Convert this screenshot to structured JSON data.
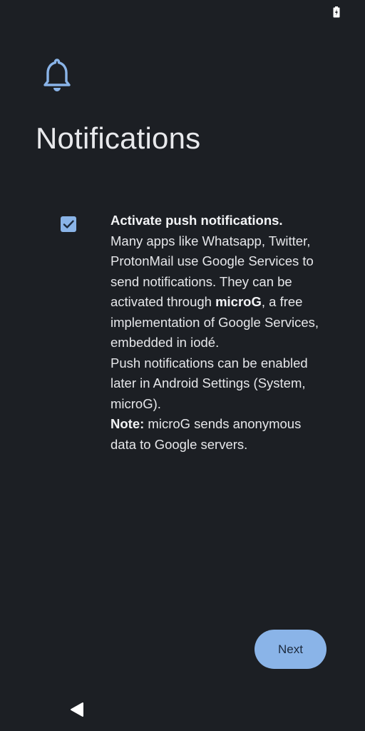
{
  "status_bar": {
    "battery_icon": "battery-charging-icon"
  },
  "header": {
    "icon": "bell-icon",
    "title": "Notifications"
  },
  "option": {
    "checked": true,
    "heading": "Activate push notifications.",
    "text_1": "Many apps like Whatsapp, Twitter, ProtonMail use Google Services to send notifications. They can be activated through ",
    "highlight": "microG",
    "text_2": ", a free implementation of Google Services, embedded in iodé.",
    "text_3": "Push notifications can be enabled later in Android Settings (System, microG).",
    "note_label": "Note:",
    "note_text": " microG sends anonymous data to Google servers."
  },
  "footer": {
    "next_label": "Next"
  },
  "nav_bar": {
    "back_icon": "back-triangle-icon"
  },
  "colors": {
    "background": "#1c1f24",
    "accent": "#8ab4e8"
  }
}
